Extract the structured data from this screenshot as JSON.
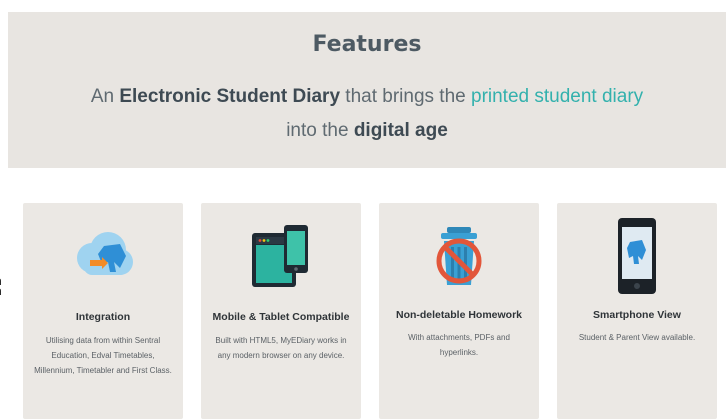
{
  "features": {
    "heading": "Features",
    "tagline": {
      "part1": "An ",
      "bold1": "Electronic Student Diary",
      "part2": " that brings the ",
      "highlight": "printed student diary",
      "line2_part1": "into the ",
      "bold2": "digital age"
    },
    "accent_color": "#33b1ad",
    "edge_text": [
      "n",
      "n"
    ],
    "cards": [
      {
        "icon": "cloud-elephant-icon",
        "title": "Integration",
        "desc_lines": [
          "Utilising data from within Sentral",
          "Education, Edval Timetables,",
          "Millennium, Timetabler and First Class."
        ]
      },
      {
        "icon": "tablet-phone-icon",
        "title": "Mobile & Tablet Compatible",
        "desc_lines": [
          "Built with HTML5, MyEDiary works in",
          "any modern browser on any device."
        ]
      },
      {
        "icon": "no-delete-trash-icon",
        "title": "Non-deletable Homework",
        "desc_lines": [
          "With attachments, PDFs and",
          "hyperlinks."
        ]
      },
      {
        "icon": "smartphone-elephant-icon",
        "title": "Smartphone View",
        "desc_lines": [
          "Student & Parent View available."
        ]
      }
    ]
  }
}
